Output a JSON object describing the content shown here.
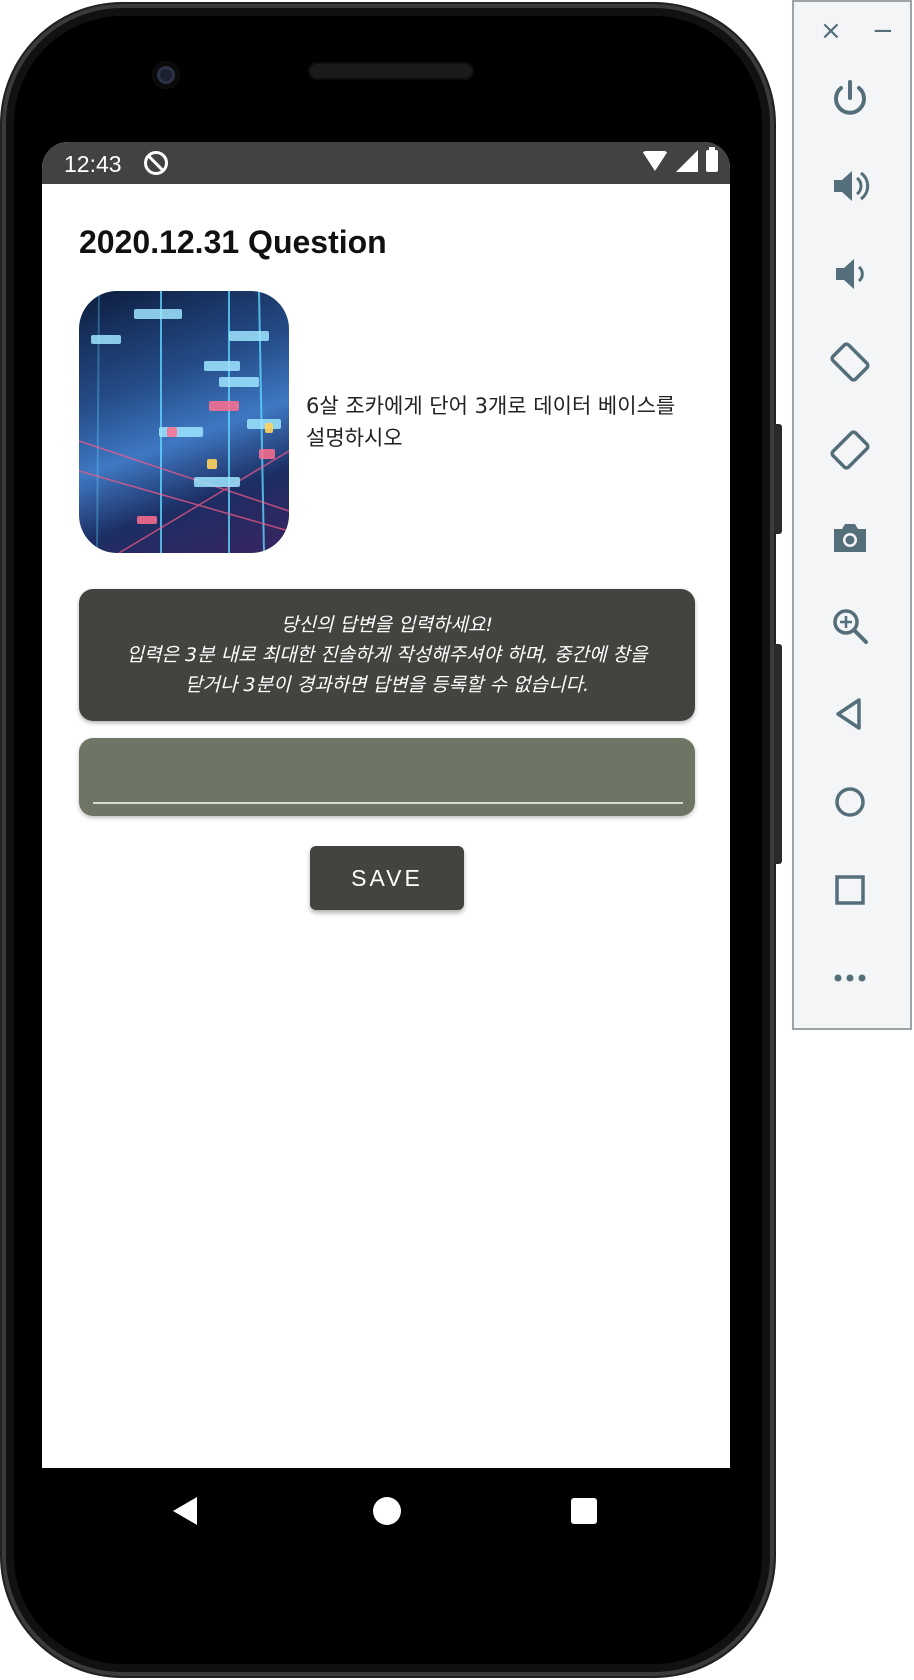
{
  "status_bar": {
    "time": "12:43"
  },
  "screen": {
    "title": "2020.12.31 Question",
    "question_text": "6살 조카에게 단어 3개로 데이터 베이스를 설명하시오",
    "instruction_line1": "당신의 답변을 입력하세요!",
    "instruction_line2": "입력은 3분 내로 최대한 진솔하게 작성해주셔야 하며, 중간에 창을 닫거나 3분이 경과하면 답변을 등록할 수 없습니다.",
    "answer_value": "",
    "save_label": "SAVE"
  },
  "emulator_toolbar": {
    "close_symbol": "×",
    "minimize_symbol": "−",
    "icons": [
      "power-icon",
      "volume-up-icon",
      "volume-down-icon",
      "rotate-left-icon",
      "rotate-right-icon",
      "camera-icon",
      "zoom-icon",
      "back-icon",
      "home-icon",
      "overview-icon",
      "more-icon"
    ]
  }
}
